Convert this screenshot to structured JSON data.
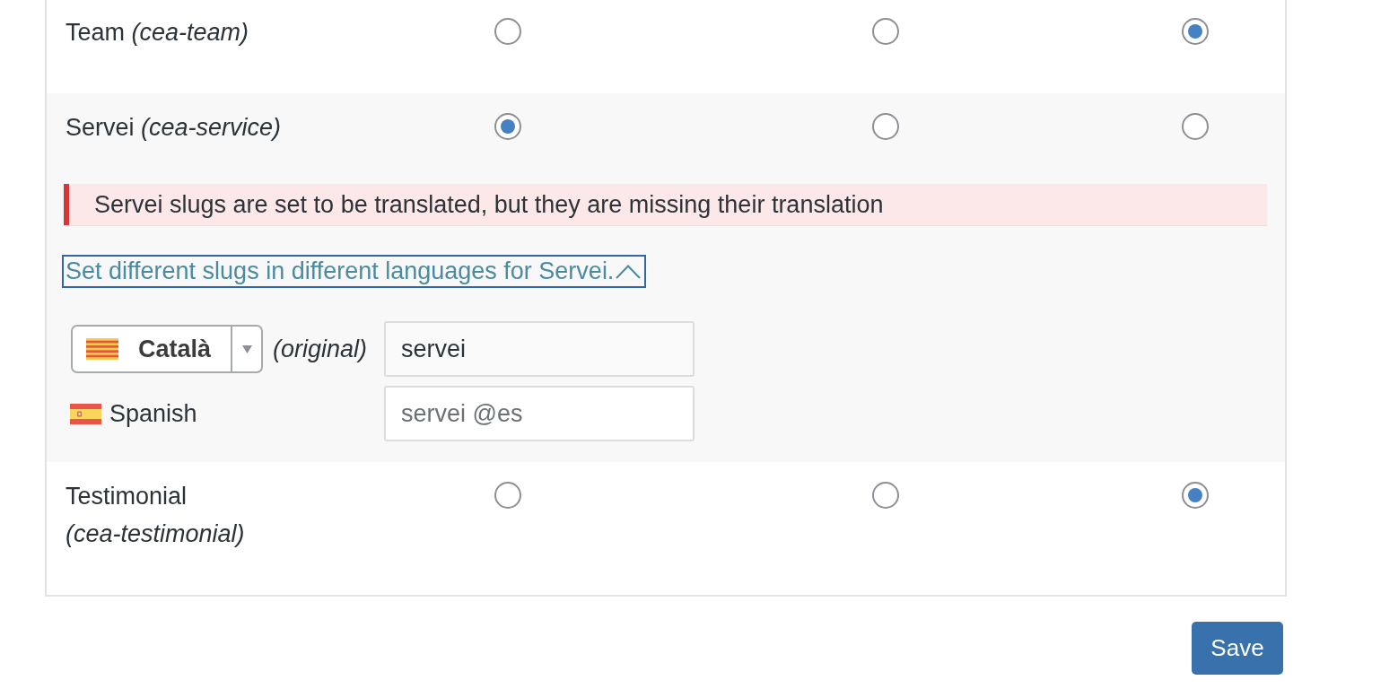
{
  "table": {
    "rows": [
      {
        "name": "Team",
        "slug": "(cea-team)",
        "options": [
          {
            "selected": false
          },
          {
            "selected": false
          },
          {
            "selected": true
          }
        ]
      },
      {
        "name": "Servei",
        "slug": "(cea-service)",
        "options": [
          {
            "selected": true
          },
          {
            "selected": false
          },
          {
            "selected": false
          }
        ],
        "notice": "Servei slugs are set to be translated, but they are missing their translation",
        "toggle": {
          "label": "Set different slugs in different languages for Servei.",
          "expanded": true,
          "focused": true
        },
        "languages": [
          {
            "kind": "original",
            "language": "Català",
            "note": "(original)",
            "value": "servei"
          },
          {
            "kind": "translation",
            "language": "Spanish",
            "placeholder": "servei @es"
          }
        ]
      },
      {
        "name": "Testimonial",
        "slug": "(cea-testimonial)",
        "options": [
          {
            "selected": false
          },
          {
            "selected": false
          },
          {
            "selected": true
          }
        ]
      }
    ]
  },
  "save_button": {
    "label": "Save"
  }
}
